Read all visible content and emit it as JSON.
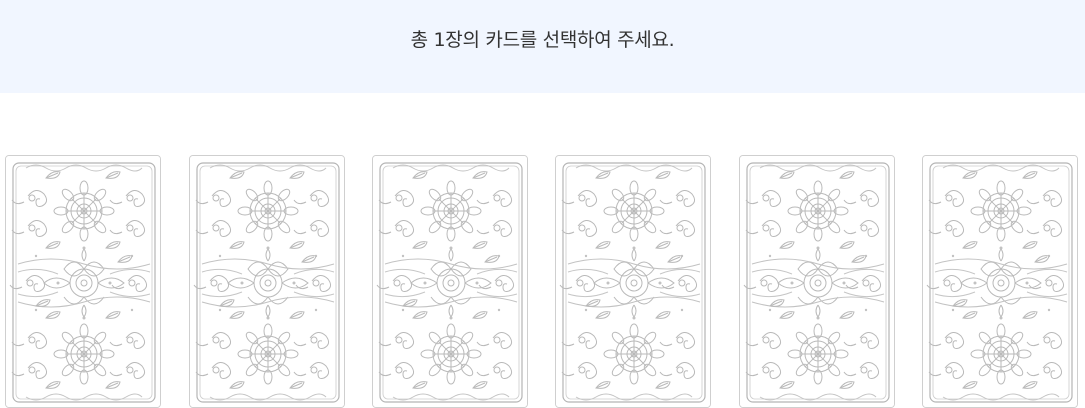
{
  "header": {
    "instruction": "총 1장의 카드를 선택하여 주세요."
  },
  "cards": [
    {
      "name": "card-1"
    },
    {
      "name": "card-2"
    },
    {
      "name": "card-3"
    },
    {
      "name": "card-4"
    },
    {
      "name": "card-5"
    },
    {
      "name": "card-6"
    }
  ],
  "colors": {
    "banner_bg": "#f1f6ff",
    "card_line": "#b9b9b9",
    "card_border": "#cfcfcf"
  }
}
